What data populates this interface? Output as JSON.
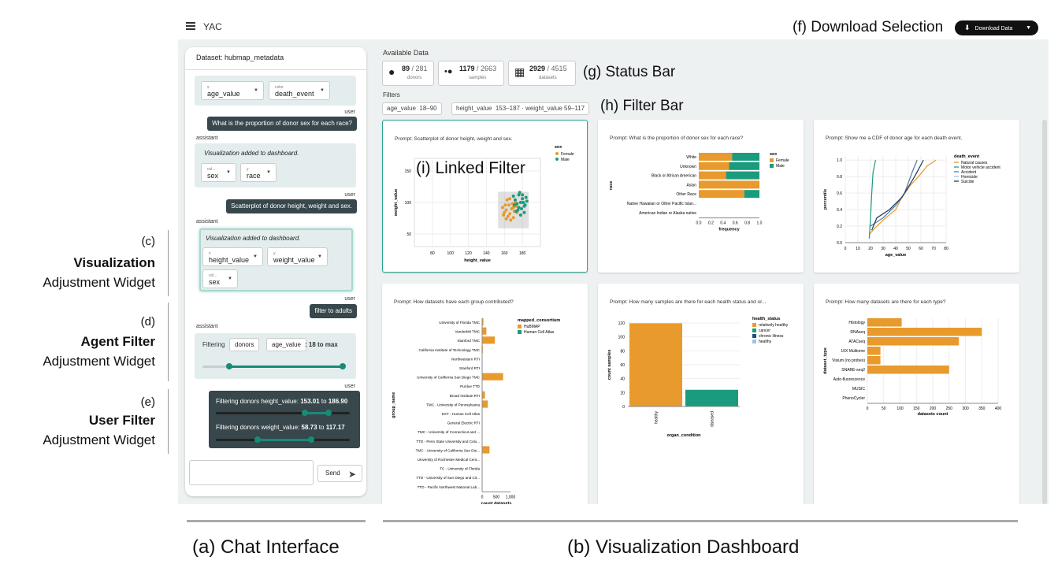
{
  "app": {
    "name": "YAC",
    "download_label": "Download Data"
  },
  "colors": {
    "accent": "#1a8a77",
    "orange": "#e89a2c",
    "teal": "#1b9b7e",
    "blue": "#1f4e79",
    "darkblue": "#1a3a5c",
    "dark": "#37474b"
  },
  "chat": {
    "dataset_label": "Dataset: hubmap_metadata",
    "enc1": {
      "x_key": "x",
      "x_value": "age_value",
      "c_key": "color",
      "c_value": "death_event"
    },
    "msg1": {
      "who": "user",
      "text": "What is the proportion of donor sex for each race?"
    },
    "resp1": {
      "who": "assistant",
      "text": "Visualization added to dashboard.",
      "col_key": "col...",
      "col_value": "sex",
      "y_key": "y",
      "y_value": "race"
    },
    "msg2": {
      "who": "user",
      "text": "Scatterplot of donor height, weight and sex."
    },
    "resp2": {
      "who": "assistant",
      "text": "Visualization added to dashboard.",
      "x_key": "x",
      "x_value": "height_value",
      "y_key": "y",
      "y_value": "weight_value",
      "col_key": "col...",
      "col_value": "sex"
    },
    "msg3": {
      "who": "user",
      "text": "filter to adults"
    },
    "resp3": {
      "who": "assistant",
      "filtering": "Filtering",
      "entity": "donors",
      "field": "age_value",
      "range_text": ": 18 to",
      "max": "max",
      "slider_low": 0.18,
      "slider_high": 1.0
    },
    "msg4": {
      "who": "user",
      "f1_prefix": "Filtering donors height_value:",
      "f1_lo": "153.01",
      "f1_mid": "to",
      "f1_hi": "186.90",
      "f2_prefix": "Filtering donors weight_value:",
      "f2_lo": "58.73",
      "f2_mid": "to",
      "f2_hi": "117.17"
    },
    "send_label": "Send"
  },
  "dashboard": {
    "available_label": "Available Data",
    "status": [
      {
        "icon": "person-icon",
        "count": "89",
        "total": "/ 281",
        "label": "donors"
      },
      {
        "icon": "dots-icon",
        "count": "1179",
        "total": "/ 2663",
        "label": "samples"
      },
      {
        "icon": "table-icon",
        "count": "2929",
        "total": "/ 4515",
        "label": "datasets"
      }
    ],
    "filters_label": "Filters",
    "filters": [
      {
        "name": "age_value",
        "range": "18–90"
      },
      {
        "name": "height_value",
        "range": "153–187 · weight_value  59–117"
      }
    ]
  },
  "cards": [
    {
      "prompt": "Prompt: Scatterplot of donor height, weight and sex."
    },
    {
      "prompt": "Prompt: What is the proportion of donor sex for each race?"
    },
    {
      "prompt": "Prompt: Show me a CDF of donor age for each death event."
    },
    {
      "prompt": "Prompt: How datasets have each group contributed?"
    },
    {
      "prompt": "Prompt: How many samples are there for each health status and or..."
    },
    {
      "prompt": "Prompt: How many datasets are there for each type?"
    }
  ],
  "chart_data": [
    {
      "type": "scatter",
      "title": "",
      "xlabel": "height_value",
      "ylabel": "weight_value",
      "xlim": [
        60,
        200
      ],
      "ylim": [
        30,
        170
      ],
      "xticks": [
        80,
        100,
        120,
        140,
        160,
        180
      ],
      "yticks": [
        50,
        100,
        150
      ],
      "legend_title": "sex",
      "series": [
        {
          "name": "Female",
          "color": "#e89a2c",
          "points": [
            [
              158,
              92
            ],
            [
              160,
              84
            ],
            [
              162,
              88
            ],
            [
              164,
              78
            ],
            [
              165,
              96
            ],
            [
              166,
              82
            ],
            [
              168,
              90
            ],
            [
              170,
              76
            ],
            [
              171,
              86
            ],
            [
              172,
              100
            ],
            [
              163,
              104
            ],
            [
              159,
              80
            ],
            [
              167,
              72
            ],
            [
              169,
              98
            ],
            [
              173,
              94
            ],
            [
              161,
              96
            ],
            [
              174,
              84
            ],
            [
              166,
              106
            ],
            [
              162,
              74
            ],
            [
              170,
              92
            ]
          ]
        },
        {
          "name": "Male",
          "color": "#1b9b7e",
          "points": [
            [
              170,
              110
            ],
            [
              172,
              104
            ],
            [
              174,
              98
            ],
            [
              176,
              112
            ],
            [
              178,
              100
            ],
            [
              180,
              106
            ],
            [
              182,
              94
            ],
            [
              184,
              108
            ],
            [
              175,
              88
            ],
            [
              177,
              116
            ],
            [
              179,
              90
            ],
            [
              181,
              100
            ],
            [
              183,
              96
            ],
            [
              185,
              102
            ],
            [
              173,
              86
            ],
            [
              178,
              80
            ],
            [
              180,
              112
            ],
            [
              176,
              92
            ],
            [
              171,
              96
            ],
            [
              182,
              84
            ]
          ]
        }
      ],
      "brush": {
        "x": [
          153,
          187
        ],
        "y": [
          59,
          117
        ]
      }
    },
    {
      "type": "bar",
      "stacked": true,
      "normalized": true,
      "title": "",
      "xlabel": "frequency",
      "ylabel": "race",
      "xlim": [
        0,
        1
      ],
      "xticks": [
        "0.0",
        "0.2",
        "0.4",
        "0.6",
        "0.8",
        "1.0"
      ],
      "legend_title": "sex",
      "categories": [
        "White",
        "Unknown",
        "Black or African American",
        "Asian",
        "Other Race",
        "Native Hawaiian or Other Pacific Islan...",
        "American Indian or Alaska native"
      ],
      "series": [
        {
          "name": "Female",
          "color": "#e89a2c",
          "values": [
            0.55,
            0.5,
            0.45,
            1.0,
            0.75,
            0,
            0
          ]
        },
        {
          "name": "Male",
          "color": "#1b9b7e",
          "values": [
            0.45,
            0.5,
            0.55,
            0,
            0.25,
            0,
            0
          ]
        }
      ]
    },
    {
      "type": "line",
      "title": "",
      "xlabel": "age_value",
      "ylabel": "percentile",
      "xlim": [
        0,
        80
      ],
      "ylim": [
        0,
        1.05
      ],
      "xticks": [
        0,
        10,
        20,
        30,
        40,
        50,
        60,
        70,
        80
      ],
      "yticks": [
        "0.0",
        "0.2",
        "0.4",
        "0.6",
        "0.8",
        "1.0"
      ],
      "legend_title": "death_event",
      "series": [
        {
          "name": "Natural causes",
          "color": "#e89a2c",
          "points": [
            [
              19,
              0.1
            ],
            [
              25,
              0.2
            ],
            [
              32,
              0.3
            ],
            [
              40,
              0.4
            ],
            [
              45,
              0.55
            ],
            [
              52,
              0.7
            ],
            [
              58,
              0.8
            ],
            [
              65,
              0.93
            ],
            [
              72,
              1.0
            ]
          ]
        },
        {
          "name": "Motor vehicle accident",
          "color": "#1b9b7e",
          "points": [
            [
              19,
              0.05
            ],
            [
              20,
              0.3
            ],
            [
              21,
              0.6
            ],
            [
              22,
              0.85
            ],
            [
              24,
              1.0
            ]
          ]
        },
        {
          "name": "Accident",
          "color": "#4a78a6",
          "points": [
            [
              20,
              0.2
            ],
            [
              30,
              0.3
            ],
            [
              40,
              0.45
            ],
            [
              47,
              0.6
            ],
            [
              53,
              0.85
            ],
            [
              57,
              1.0
            ]
          ]
        },
        {
          "name": "Homicide",
          "color": "#9ec3e6",
          "points": []
        },
        {
          "name": "Suicide",
          "color": "#1a3a5c",
          "points": [
            [
              21,
              0.15
            ],
            [
              25,
              0.3
            ],
            [
              35,
              0.4
            ],
            [
              45,
              0.55
            ],
            [
              55,
              0.8
            ],
            [
              62,
              1.0
            ]
          ]
        }
      ]
    },
    {
      "type": "bar",
      "stacked": true,
      "title": "",
      "xlabel": "count datasets",
      "ylabel": "group_name",
      "xlim": [
        0,
        1000
      ],
      "xticks": [
        "0",
        "500",
        "1,000"
      ],
      "legend_title": "mapped_consortium",
      "categories": [
        "University of Florida TMC",
        "Vanderbilt TMC",
        "Stanford TMC",
        "California Institute of Technology TMC",
        "Northwestern RTI",
        "Stanford RTI",
        "University of California San Diego TMC",
        "Purdue TTD",
        "Broad Institute RTI",
        "TMC - University of Pennsylvania",
        "EXT - Human Cell Atlas",
        "General Electric RTI",
        "TMC - University of Connecticut and ...",
        "TTD - Penn State University and Colu...",
        "TMC - University of California San Die...",
        "University of Rochester Medical Cent...",
        "TC - University of Florida",
        "TTD - University of San Diego and Cit...",
        "TTD - Pacific Northwest National Lab..."
      ],
      "series": [
        {
          "name": "HuBMAP",
          "color": "#e89a2c",
          "values": [
            45,
            150,
            450,
            25,
            0,
            0,
            740,
            0,
            100,
            200,
            0,
            0,
            10,
            0,
            260,
            0,
            0,
            0,
            0
          ]
        },
        {
          "name": "Human Cell Atlas",
          "color": "#1b9b7e",
          "values": [
            0,
            0,
            0,
            0,
            0,
            0,
            0,
            0,
            0,
            0,
            0,
            0,
            0,
            0,
            0,
            0,
            0,
            0,
            0
          ]
        }
      ]
    },
    {
      "type": "bar",
      "stacked": true,
      "title": "",
      "xlabel": "organ_condition",
      "ylabel": "count samples",
      "ylim": [
        0,
        120
      ],
      "yticks": [
        0,
        20,
        40,
        60,
        80,
        100,
        120
      ],
      "legend_title": "health_status",
      "categories": [
        "healthy",
        "diseased"
      ],
      "series": [
        {
          "name": "relatively healthy",
          "color": "#e89a2c",
          "values": [
            119,
            0
          ]
        },
        {
          "name": "cancer",
          "color": "#1b9b7e",
          "values": [
            0,
            24
          ]
        },
        {
          "name": "chronic illness",
          "color": "#1f4e79",
          "values": [
            0,
            0
          ]
        },
        {
          "name": "healthy",
          "color": "#9ec3e6",
          "values": [
            1,
            0
          ]
        }
      ]
    },
    {
      "type": "bar",
      "title": "",
      "xlabel": "datasets count",
      "ylabel": "dataset_type",
      "xlim": [
        0,
        400
      ],
      "xticks": [
        0,
        50,
        100,
        150,
        200,
        250,
        300,
        350,
        400
      ],
      "categories": [
        "Histology",
        "RNAseq",
        "ATACseq",
        "10X Multiome",
        "Visium (no probes)",
        "SNARE-seq2",
        "Auto-fluorescence",
        "MUSIC",
        "PhenoCycler"
      ],
      "values": [
        105,
        350,
        280,
        40,
        40,
        250,
        0,
        0,
        0
      ],
      "color": "#e89a2c"
    }
  ],
  "annotations": {
    "a": "(a) Chat Interface",
    "b": "(b) Visualization Dashboard",
    "c1": "(c)",
    "c2": "Visualization",
    "c3": "Adjustment Widget",
    "d1": "(d)",
    "d2": "Agent Filter",
    "d3": "Adjustment Widget",
    "e1": "(e)",
    "e2": "User Filter",
    "e3": "Adjustment Widget",
    "f": "(f) Download Selection",
    "g": "(g) Status Bar",
    "h": "(h) Filter Bar",
    "i": "(i) Linked Filter"
  }
}
